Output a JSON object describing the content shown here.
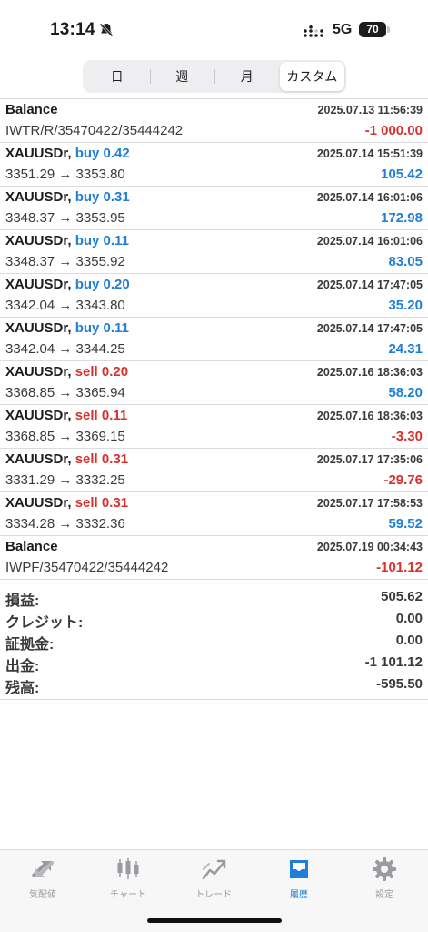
{
  "status": {
    "time": "13:14",
    "network": "5G",
    "battery": "70"
  },
  "period_tabs": [
    {
      "label": "日"
    },
    {
      "label": "週"
    },
    {
      "label": "月"
    },
    {
      "label": "カスタム"
    }
  ],
  "deals": [
    {
      "symbol": "Balance",
      "action": "",
      "action_type": "",
      "detail": "IWTR/R/35470422/35444242",
      "time": "2025.07.13 11:56:39",
      "profit": "-1 000.00",
      "profit_sign": "neg"
    },
    {
      "symbol": "XAUUSDr,",
      "action": "buy 0.42",
      "action_type": "buy",
      "detail": "3351.29 → 3353.80",
      "time": "2025.07.14 15:51:39",
      "profit": "105.42",
      "profit_sign": "pos"
    },
    {
      "symbol": "XAUUSDr,",
      "action": "buy 0.31",
      "action_type": "buy",
      "detail": "3348.37 → 3353.95",
      "time": "2025.07.14 16:01:06",
      "profit": "172.98",
      "profit_sign": "pos"
    },
    {
      "symbol": "XAUUSDr,",
      "action": "buy 0.11",
      "action_type": "buy",
      "detail": "3348.37 → 3355.92",
      "time": "2025.07.14 16:01:06",
      "profit": "83.05",
      "profit_sign": "pos"
    },
    {
      "symbol": "XAUUSDr,",
      "action": "buy 0.20",
      "action_type": "buy",
      "detail": "3342.04 → 3343.80",
      "time": "2025.07.14 17:47:05",
      "profit": "35.20",
      "profit_sign": "pos"
    },
    {
      "symbol": "XAUUSDr,",
      "action": "buy 0.11",
      "action_type": "buy",
      "detail": "3342.04 → 3344.25",
      "time": "2025.07.14 17:47:05",
      "profit": "24.31",
      "profit_sign": "pos"
    },
    {
      "symbol": "XAUUSDr,",
      "action": "sell 0.20",
      "action_type": "sell",
      "detail": "3368.85 → 3365.94",
      "time": "2025.07.16 18:36:03",
      "profit": "58.20",
      "profit_sign": "pos"
    },
    {
      "symbol": "XAUUSDr,",
      "action": "sell 0.11",
      "action_type": "sell",
      "detail": "3368.85 → 3369.15",
      "time": "2025.07.16 18:36:03",
      "profit": "-3.30",
      "profit_sign": "neg"
    },
    {
      "symbol": "XAUUSDr,",
      "action": "sell 0.31",
      "action_type": "sell",
      "detail": "3331.29 → 3332.25",
      "time": "2025.07.17 17:35:06",
      "profit": "-29.76",
      "profit_sign": "neg"
    },
    {
      "symbol": "XAUUSDr,",
      "action": "sell 0.31",
      "action_type": "sell",
      "detail": "3334.28 → 3332.36",
      "time": "2025.07.17 17:58:53",
      "profit": "59.52",
      "profit_sign": "pos"
    },
    {
      "symbol": "Balance",
      "action": "",
      "action_type": "",
      "detail": "IWPF/35470422/35444242",
      "time": "2025.07.19 00:34:43",
      "profit": "-101.12",
      "profit_sign": "neg"
    }
  ],
  "summary": [
    {
      "label": "損益:",
      "value": "505.62"
    },
    {
      "label": "クレジット:",
      "value": "0.00"
    },
    {
      "label": "証拠金:",
      "value": "0.00"
    },
    {
      "label": "出金:",
      "value": "-1 101.12"
    },
    {
      "label": "残高:",
      "value": "-595.50"
    }
  ],
  "tabbar": [
    {
      "label": "気配値",
      "icon": "quotes-icon"
    },
    {
      "label": "チャート",
      "icon": "chart-icon"
    },
    {
      "label": "トレード",
      "icon": "trade-icon"
    },
    {
      "label": "履歴",
      "icon": "history-icon",
      "active": true
    },
    {
      "label": "設定",
      "icon": "settings-icon"
    }
  ],
  "colors": {
    "accent": "#1e7ed8",
    "negative": "#d6312c",
    "inactive_icon": "#9a9aa0"
  }
}
